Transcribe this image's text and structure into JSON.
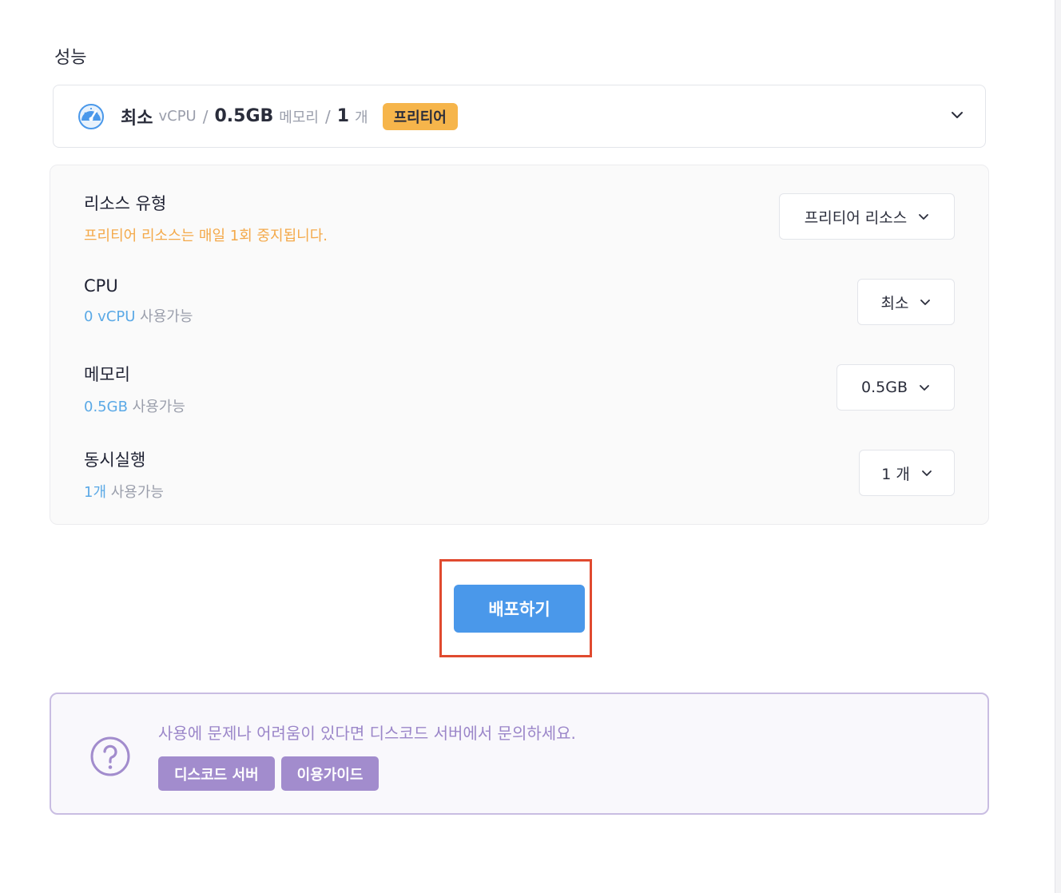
{
  "section": {
    "title": "성능"
  },
  "summary": {
    "level": "최소",
    "cpu_unit": "vCPU",
    "separator": "/",
    "memory": "0.5GB",
    "memory_unit": "메모리",
    "count": "1",
    "count_unit": "개",
    "badge": "프리티어",
    "icon": "speedometer-icon"
  },
  "panel": {
    "rows": [
      {
        "label": "리소스 유형",
        "sub_warning": "프리티어 리소스는 매일 1회 중지됩니다.",
        "select": "프리티어 리소스"
      },
      {
        "label": "CPU",
        "sub_value": "0 vCPU",
        "sub_suffix": "사용가능",
        "select": "최소"
      },
      {
        "label": "메모리",
        "sub_value": "0.5GB",
        "sub_suffix": "사용가능",
        "select": "0.5GB"
      },
      {
        "label": "동시실행",
        "sub_value": "1개",
        "sub_suffix": "사용가능",
        "select": "1 개"
      }
    ]
  },
  "deploy": {
    "label": "배포하기"
  },
  "help": {
    "text": "사용에 문제나 어려움이 있다면 디스코드 서버에서 문의하세요.",
    "buttons": [
      "디스코드 서버",
      "이용가이드"
    ],
    "icon": "question-circle-icon"
  },
  "colors": {
    "accent": "#4a98ea",
    "badge": "#f6b54b",
    "warning": "#f4a94a",
    "info": "#5ba9e6",
    "help": "#a28ccd",
    "highlight": "#e04a2f"
  }
}
